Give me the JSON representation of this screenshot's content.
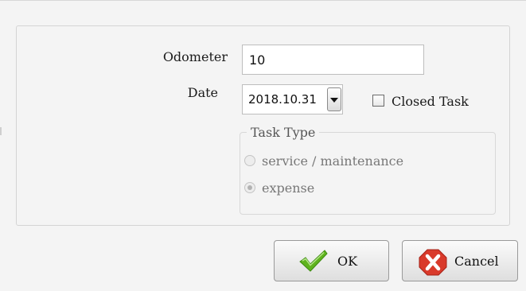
{
  "form": {
    "odometer_label": "Odometer",
    "odometer_value": "10",
    "date_label": "Date",
    "date_value": "2018.10.31",
    "closed_task_label": "Closed Task",
    "closed_task_checked": false
  },
  "task_type": {
    "legend": "Task Type",
    "options": [
      {
        "label": "service / maintenance",
        "selected": false,
        "enabled": false
      },
      {
        "label": "expense",
        "selected": true,
        "enabled": false
      }
    ]
  },
  "buttons": {
    "ok_label": "OK",
    "ok_icon": "green-checkmark-icon",
    "cancel_label": "Cancel",
    "cancel_icon": "red-x-icon"
  },
  "colors": {
    "ok_icon": "#5fb31e",
    "cancel_icon": "#d93a2b",
    "disabled_text": "#777777"
  }
}
